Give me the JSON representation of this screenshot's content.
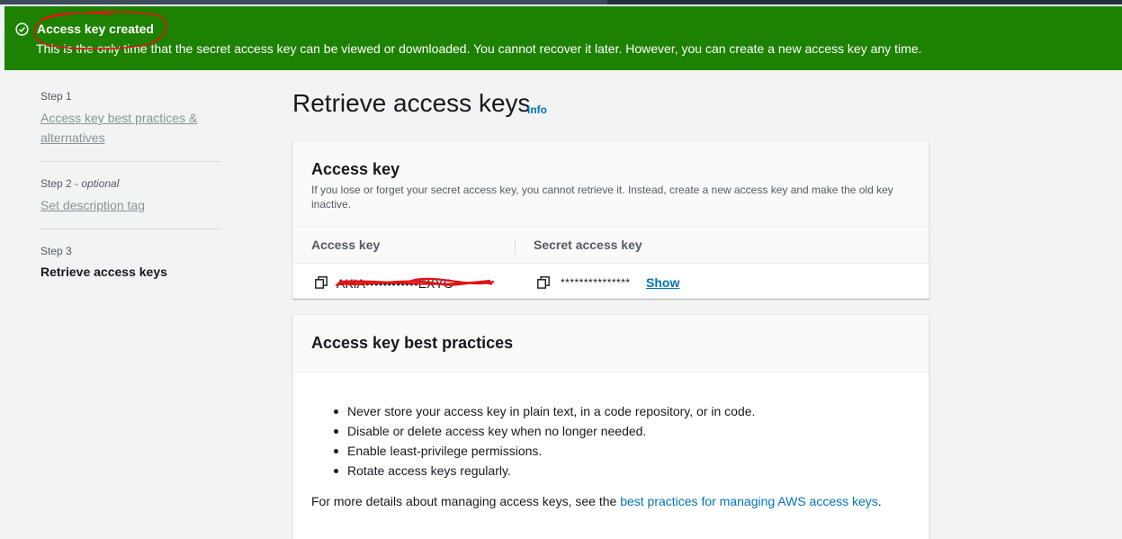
{
  "flash": {
    "title": "Access key created",
    "message": "This is the only time that the secret access key can be viewed or downloaded. You cannot recover it later. However, you can create a new access key any time."
  },
  "steps": [
    {
      "number": "Step 1",
      "optional": "",
      "label": "Access key best practices & alternatives"
    },
    {
      "number": "Step 2 - ",
      "optional": "optional",
      "label": "Set description tag"
    },
    {
      "number": "Step 3",
      "optional": "",
      "label": "Retrieve access keys"
    }
  ],
  "page": {
    "title": "Retrieve access keys",
    "info_link": "Info"
  },
  "access_key_card": {
    "heading": "Access key",
    "description": "If you lose or forget your secret access key, you cannot retrieve it. Instead, create a new access key and make the old key inactive.",
    "col_access_key": "Access key",
    "col_secret_key": "Secret access key",
    "access_key_value": "AKIA••••••••••••EXYG",
    "secret_masked": "***************",
    "show_label": "Show"
  },
  "best_practices_card": {
    "heading": "Access key best practices",
    "items": [
      "Never store your access key in plain text, in a code repository, or in code.",
      "Disable or delete access key when no longer needed.",
      "Enable least-privilege permissions.",
      "Rotate access keys regularly."
    ],
    "more_prefix": "For more details about managing access keys, see the ",
    "more_link": "best practices for managing AWS access keys",
    "more_suffix": "."
  },
  "colors": {
    "success": "#1d8102",
    "link": "#0073bb",
    "annotation": "#e01515"
  }
}
